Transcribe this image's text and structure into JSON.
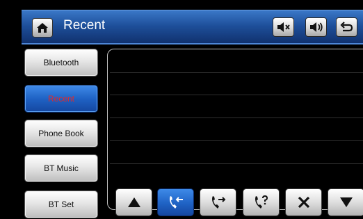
{
  "header": {
    "title": "Recent",
    "home_icon": "home-icon",
    "mute_icon": "speaker-mute-icon",
    "volume_icon": "speaker-volume-icon",
    "back_icon": "return-arrow-icon"
  },
  "sidebar": {
    "items": [
      {
        "label": "Bluetooth",
        "active": false
      },
      {
        "label": "Recent",
        "active": true
      },
      {
        "label": "Phone Book",
        "active": false
      },
      {
        "label": "BT Music",
        "active": false
      },
      {
        "label": "BT Set",
        "active": false
      }
    ]
  },
  "call_list": {
    "rows": []
  },
  "toolbar": {
    "buttons": [
      {
        "icon": "scroll-up-icon",
        "active": false
      },
      {
        "icon": "received-calls-icon",
        "active": true
      },
      {
        "icon": "dialed-calls-icon",
        "active": false
      },
      {
        "icon": "missed-calls-icon",
        "active": false
      },
      {
        "icon": "delete-icon",
        "active": false
      },
      {
        "icon": "scroll-down-icon",
        "active": false
      }
    ]
  },
  "colors": {
    "header_blue": "#1e4f9a",
    "active_blue": "#1f62c4",
    "active_text_red": "#e22a2a"
  }
}
